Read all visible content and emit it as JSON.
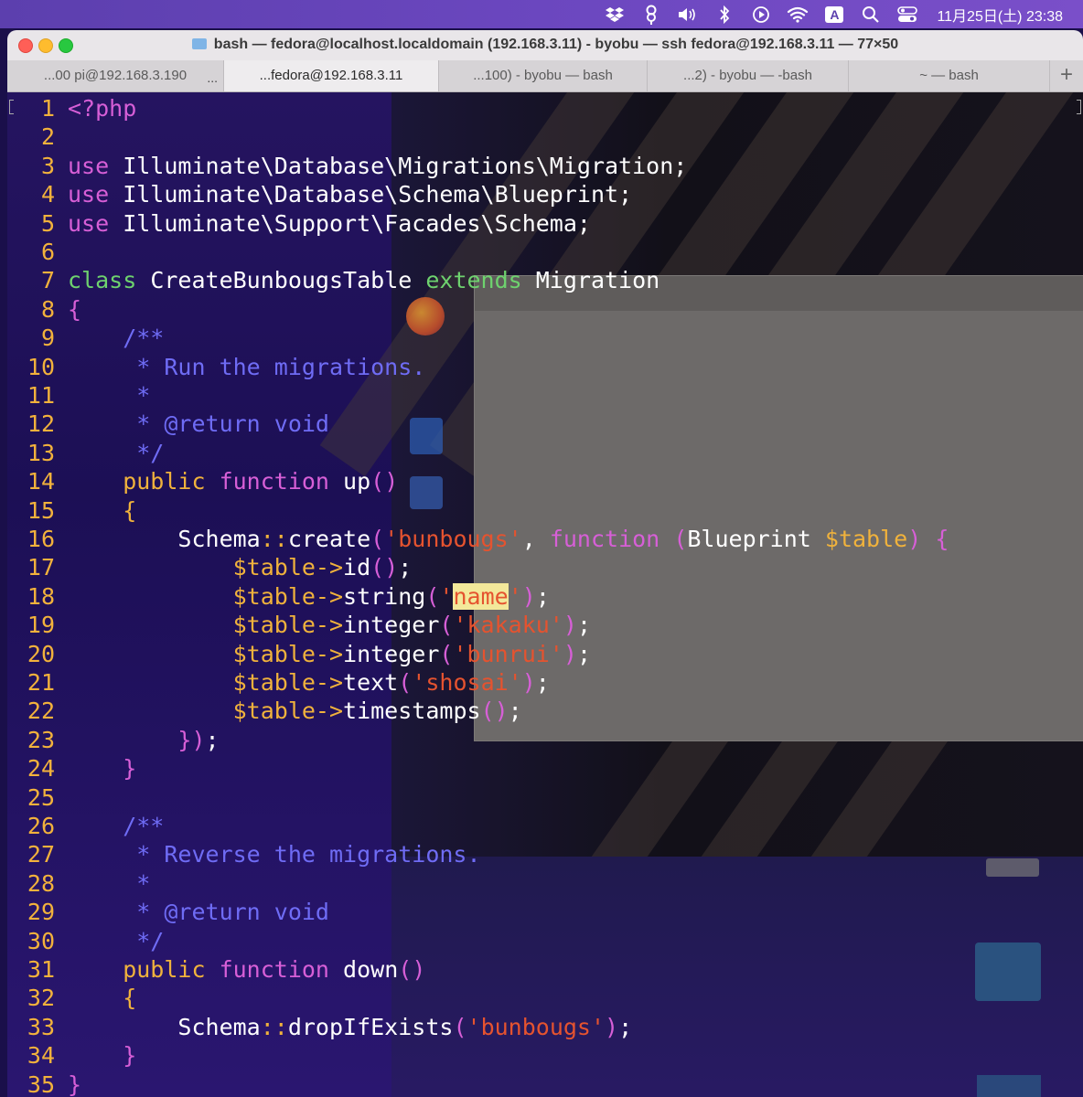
{
  "menubar": {
    "icons": [
      "dropbox-icon",
      "pin-icon",
      "volume-icon",
      "bluetooth-icon",
      "play-icon",
      "wifi-icon",
      "input-source-icon",
      "search-icon",
      "control-center-icon"
    ],
    "input_source": "A",
    "datetime": "11月25日(土) 23:38"
  },
  "window": {
    "title": "bash — fedora@localhost.localdomain (192.168.3.11) - byobu — ssh fedora@192.168.3.11 — 77×50",
    "tabs": [
      {
        "label": "...00 pi@192.168.3.190",
        "active": false,
        "extra": "..."
      },
      {
        "label": "...fedora@192.168.3.11",
        "active": true
      },
      {
        "label": "...100) - byobu — bash",
        "active": false
      },
      {
        "label": "...2) - byobu — -bash",
        "active": false
      },
      {
        "label": "~ — bash",
        "active": false
      }
    ],
    "add_tab": "+"
  },
  "editor": {
    "language": "php",
    "lines": [
      {
        "n": "1",
        "segs": [
          {
            "t": "<?php",
            "c": "kw"
          }
        ]
      },
      {
        "n": "2",
        "segs": []
      },
      {
        "n": "3",
        "segs": [
          {
            "t": "use",
            "c": "kw"
          },
          {
            "t": " Illuminate\\Database\\Migrations\\Migration;",
            "c": "white"
          }
        ]
      },
      {
        "n": "4",
        "segs": [
          {
            "t": "use",
            "c": "kw"
          },
          {
            "t": " Illuminate\\Database\\Schema\\Blueprint;",
            "c": "white"
          }
        ]
      },
      {
        "n": "5",
        "segs": [
          {
            "t": "use",
            "c": "kw"
          },
          {
            "t": " Illuminate\\Support\\Facades\\Schema;",
            "c": "white"
          }
        ]
      },
      {
        "n": "6",
        "segs": []
      },
      {
        "n": "7",
        "segs": [
          {
            "t": "class",
            "c": "ext"
          },
          {
            "t": " CreateBunbougsTable ",
            "c": "white"
          },
          {
            "t": "extends",
            "c": "ext"
          },
          {
            "t": " Migration",
            "c": "white"
          }
        ]
      },
      {
        "n": "8",
        "segs": [
          {
            "t": "{",
            "c": "paren"
          }
        ]
      },
      {
        "n": "9",
        "segs": [
          {
            "t": "    /**",
            "c": "cm"
          }
        ]
      },
      {
        "n": "10",
        "segs": [
          {
            "t": "     * Run the migrations.",
            "c": "cm"
          }
        ]
      },
      {
        "n": "11",
        "segs": [
          {
            "t": "     *",
            "c": "cm"
          }
        ]
      },
      {
        "n": "12",
        "segs": [
          {
            "t": "     * @return void",
            "c": "cm"
          }
        ]
      },
      {
        "n": "13",
        "segs": [
          {
            "t": "     */",
            "c": "cm"
          }
        ]
      },
      {
        "n": "14",
        "segs": [
          {
            "t": "    public",
            "c": "var"
          },
          {
            "t": " ",
            "c": "white"
          },
          {
            "t": "function",
            "c": "kw"
          },
          {
            "t": " up",
            "c": "white"
          },
          {
            "t": "()",
            "c": "paren"
          }
        ]
      },
      {
        "n": "15",
        "segs": [
          {
            "t": "    {",
            "c": "var"
          }
        ]
      },
      {
        "n": "16",
        "segs": [
          {
            "t": "        Schema",
            "c": "white"
          },
          {
            "t": "::",
            "c": "op"
          },
          {
            "t": "create",
            "c": "white"
          },
          {
            "t": "(",
            "c": "paren"
          },
          {
            "t": "'bunbougs'",
            "c": "str"
          },
          {
            "t": ", ",
            "c": "white"
          },
          {
            "t": "function",
            "c": "kw"
          },
          {
            "t": " ",
            "c": "white"
          },
          {
            "t": "(",
            "c": "paren"
          },
          {
            "t": "Blueprint ",
            "c": "white"
          },
          {
            "t": "$table",
            "c": "var"
          },
          {
            "t": ")",
            "c": "paren"
          },
          {
            "t": " ",
            "c": "white"
          },
          {
            "t": "{",
            "c": "paren"
          }
        ]
      },
      {
        "n": "17",
        "segs": [
          {
            "t": "            $table->",
            "c": "var"
          },
          {
            "t": "id",
            "c": "white"
          },
          {
            "t": "()",
            "c": "paren"
          },
          {
            "t": ";",
            "c": "white"
          }
        ]
      },
      {
        "n": "18",
        "segs": [
          {
            "t": "            $table->",
            "c": "var"
          },
          {
            "t": "string",
            "c": "white"
          },
          {
            "t": "(",
            "c": "paren"
          },
          {
            "t": "'",
            "c": "str"
          },
          {
            "t": "name",
            "c": "hl"
          },
          {
            "t": "'",
            "c": "str"
          },
          {
            "t": ")",
            "c": "paren"
          },
          {
            "t": ";",
            "c": "white"
          }
        ]
      },
      {
        "n": "19",
        "segs": [
          {
            "t": "            $table->",
            "c": "var"
          },
          {
            "t": "integer",
            "c": "white"
          },
          {
            "t": "(",
            "c": "paren"
          },
          {
            "t": "'kakaku'",
            "c": "str"
          },
          {
            "t": ")",
            "c": "paren"
          },
          {
            "t": ";",
            "c": "white"
          }
        ]
      },
      {
        "n": "20",
        "segs": [
          {
            "t": "            $table->",
            "c": "var"
          },
          {
            "t": "integer",
            "c": "white"
          },
          {
            "t": "(",
            "c": "paren"
          },
          {
            "t": "'bunrui'",
            "c": "str"
          },
          {
            "t": ")",
            "c": "paren"
          },
          {
            "t": ";",
            "c": "white"
          }
        ]
      },
      {
        "n": "21",
        "segs": [
          {
            "t": "            $table->",
            "c": "var"
          },
          {
            "t": "text",
            "c": "white"
          },
          {
            "t": "(",
            "c": "paren"
          },
          {
            "t": "'shosai'",
            "c": "str"
          },
          {
            "t": ")",
            "c": "paren"
          },
          {
            "t": ";",
            "c": "white"
          }
        ]
      },
      {
        "n": "22",
        "segs": [
          {
            "t": "            $table->",
            "c": "var"
          },
          {
            "t": "timestamps",
            "c": "white"
          },
          {
            "t": "()",
            "c": "paren"
          },
          {
            "t": ";",
            "c": "white"
          }
        ]
      },
      {
        "n": "23",
        "segs": [
          {
            "t": "        })",
            "c": "paren"
          },
          {
            "t": ";",
            "c": "white"
          }
        ]
      },
      {
        "n": "24",
        "segs": [
          {
            "t": "    }",
            "c": "paren"
          }
        ]
      },
      {
        "n": "25",
        "segs": []
      },
      {
        "n": "26",
        "segs": [
          {
            "t": "    /**",
            "c": "cm"
          }
        ]
      },
      {
        "n": "27",
        "segs": [
          {
            "t": "     * Reverse the migrations.",
            "c": "cm"
          }
        ]
      },
      {
        "n": "28",
        "segs": [
          {
            "t": "     *",
            "c": "cm"
          }
        ]
      },
      {
        "n": "29",
        "segs": [
          {
            "t": "     * @return void",
            "c": "cm"
          }
        ]
      },
      {
        "n": "30",
        "segs": [
          {
            "t": "     */",
            "c": "cm"
          }
        ]
      },
      {
        "n": "31",
        "segs": [
          {
            "t": "    public",
            "c": "var"
          },
          {
            "t": " ",
            "c": "white"
          },
          {
            "t": "function",
            "c": "kw"
          },
          {
            "t": " down",
            "c": "white"
          },
          {
            "t": "()",
            "c": "paren"
          }
        ]
      },
      {
        "n": "32",
        "segs": [
          {
            "t": "    {",
            "c": "var"
          }
        ]
      },
      {
        "n": "33",
        "segs": [
          {
            "t": "        Schema",
            "c": "white"
          },
          {
            "t": "::",
            "c": "op"
          },
          {
            "t": "dropIfExists",
            "c": "white"
          },
          {
            "t": "(",
            "c": "paren"
          },
          {
            "t": "'bunbougs'",
            "c": "str"
          },
          {
            "t": ")",
            "c": "paren"
          },
          {
            "t": ";",
            "c": "white"
          }
        ]
      },
      {
        "n": "34",
        "segs": [
          {
            "t": "    }",
            "c": "paren"
          }
        ]
      },
      {
        "n": "35",
        "segs": [
          {
            "t": "}",
            "c": "paren"
          }
        ]
      }
    ]
  },
  "colors": {
    "keyword": "#d75fd7",
    "extends_keyword": "#6ed26e",
    "string": "#e5532f",
    "comment": "#6f6cf5",
    "variable": "#f0b23c",
    "line_number": "#f2b23c",
    "search_highlight": "#f3e89a"
  }
}
